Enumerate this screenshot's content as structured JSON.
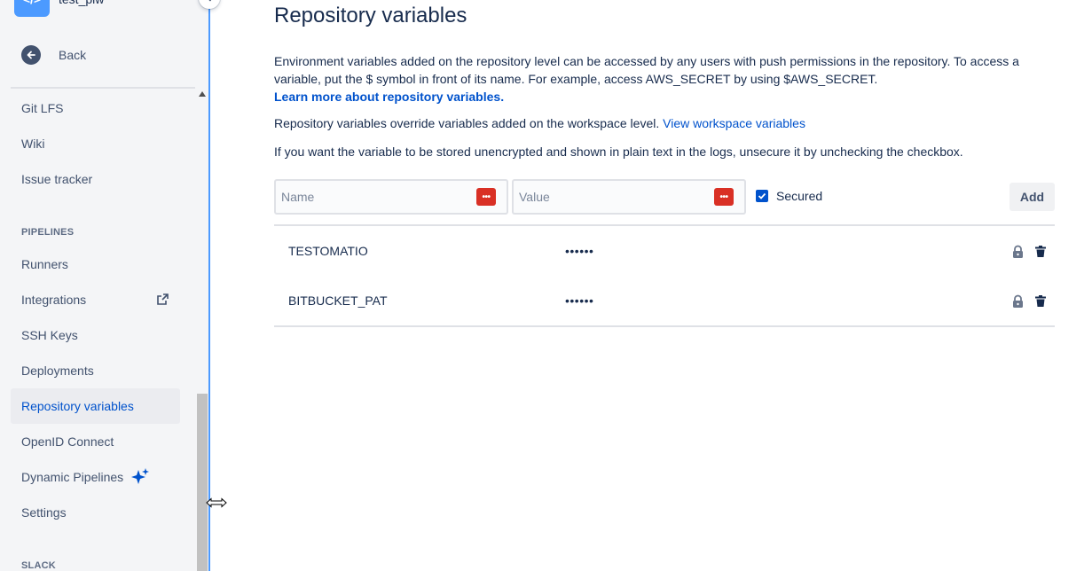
{
  "sidebar": {
    "repo_avatar": "</>",
    "repo_name": "test_plw",
    "back_label": "Back",
    "items": [
      {
        "label": "Git LFS"
      },
      {
        "label": "Wiki"
      },
      {
        "label": "Issue tracker"
      }
    ],
    "pipelines_heading": "PIPELINES",
    "pipeline_items": [
      {
        "label": "Runners"
      },
      {
        "label": "Integrations"
      },
      {
        "label": "SSH Keys"
      },
      {
        "label": "Deployments"
      },
      {
        "label": "Repository variables"
      },
      {
        "label": "OpenID Connect"
      },
      {
        "label": "Dynamic Pipelines"
      },
      {
        "label": "Settings"
      }
    ],
    "slack_heading": "SLACK"
  },
  "main": {
    "title": "Repository variables",
    "description": "Environment variables added on the repository level can be accessed by any users with push permissions in the repository. To access a variable, put the $ symbol in front of its name. For example, access AWS_SECRET by using $AWS_SECRET.",
    "learn_more_link": "Learn more about repository variables.",
    "override_text": "Repository variables override variables added on the workspace level.",
    "workspace_link": "View workspace variables",
    "unsecure_text": "If you want the variable to be stored unencrypted and shown in plain text in the logs, unsecure it by unchecking the checkbox.",
    "form": {
      "name_placeholder": "Name",
      "value_placeholder": "Value",
      "name_value": "",
      "value_value": "",
      "secured_label": "Secured",
      "secured_checked": true,
      "add_label": "Add"
    },
    "variables": [
      {
        "name": "TESTOMATIO",
        "value": "••••••"
      },
      {
        "name": "BITBUCKET_PAT",
        "value": "••••••"
      }
    ]
  },
  "colors": {
    "accent": "#0052cc",
    "sidebar_bg": "#f4f5f7",
    "password_manager_icon": "#d93025"
  }
}
